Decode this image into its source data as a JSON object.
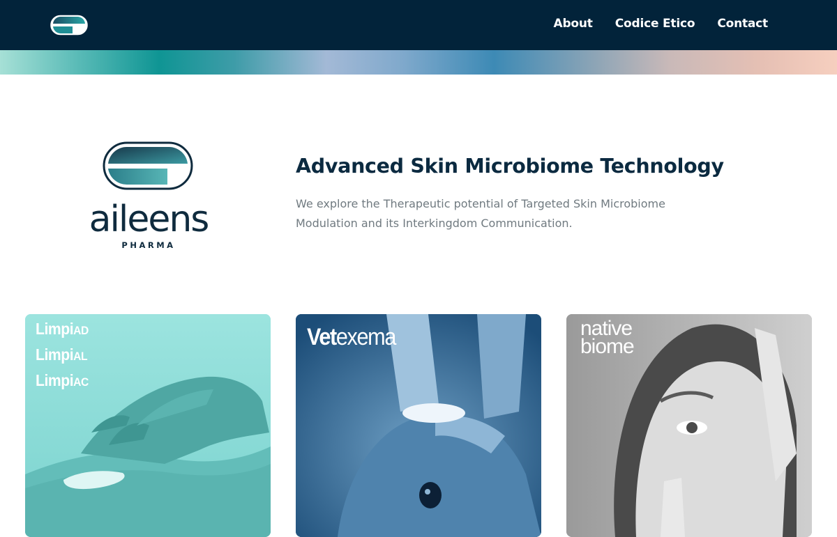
{
  "nav": {
    "logo": "aileens-pharma-logo-mark",
    "items": [
      {
        "label": "About"
      },
      {
        "label": "Codice Etico"
      },
      {
        "label": "Contact"
      }
    ]
  },
  "brand": {
    "name": "aileens",
    "sub": "PHARMA"
  },
  "hero": {
    "title": "Advanced Skin Microbiome Technology",
    "text": "We explore the Therapeutic potential of Targeted Skin Microbiome Modulation and its Interkingdom Communication."
  },
  "cards": [
    {
      "brands": [
        {
          "main": "Limpi",
          "suffix": "AD"
        },
        {
          "main": "Limpi",
          "suffix": "AL"
        },
        {
          "main": "Limpi",
          "suffix": "AC"
        }
      ],
      "image": "hand-applying-cream-on-skin"
    },
    {
      "brand_bold": "Vet",
      "brand_light": "exema",
      "image": "dog-ear-being-cleaned-with-cotton-pad"
    },
    {
      "brand_line1": "native",
      "brand_line2": "biome",
      "image": "woman-face-portrait"
    }
  ],
  "colors": {
    "topbar": "#02233a",
    "title": "#0b2a40",
    "body_text": "#707a80",
    "teal": "#0f9594"
  }
}
